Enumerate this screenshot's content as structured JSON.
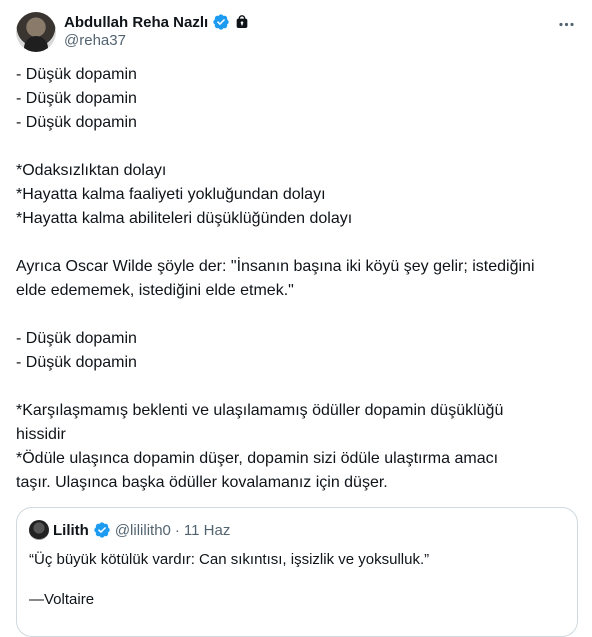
{
  "author": {
    "display_name": "Abdullah Reha Nazlı",
    "handle": "@reha37",
    "verified_icon": "verified-badge-icon",
    "lock_icon": "lock-icon"
  },
  "more_icon": "more-horizontal-icon",
  "tweet_lines": [
    "- Düşük dopamin",
    "- Düşük dopamin",
    "- Düşük dopamin",
    "",
    "*Odaksızlıktan dolayı",
    "*Hayatta kalma faaliyeti yokluğundan dolayı",
    "*Hayatta kalma abiliteleri düşüklüğünden dolayı",
    "",
    "Ayrıca Oscar Wilde şöyle der: \"İnsanın başına iki köyü şey gelir; istediğini",
    "elde edememek, istediğini elde etmek.\"",
    "",
    "- Düşük dopamin",
    "- Düşük dopamin",
    "",
    "*Karşılaşmamış beklenti ve ulaşılamamış ödüller dopamin düşüklüğü",
    "hissidir",
    "*Ödüle ulaşınca dopamin düşer, dopamin sizi ödüle ulaştırma amacı",
    "taşır. Ulaşınca başka ödüller kovalamanız için düşer."
  ],
  "quote": {
    "display_name": "Lilith",
    "handle": "@lililith0",
    "separator": "·",
    "date": "11 Haz",
    "lines": [
      "“Üç büyük kötülük vardır: Can sıkıntısı, işsizlik ve yoksulluk.”",
      "",
      "—Voltaire"
    ]
  },
  "colors": {
    "text": "#0f1419",
    "secondary": "#536471",
    "verified": "#1d9bf0",
    "border": "#cfd9de"
  }
}
